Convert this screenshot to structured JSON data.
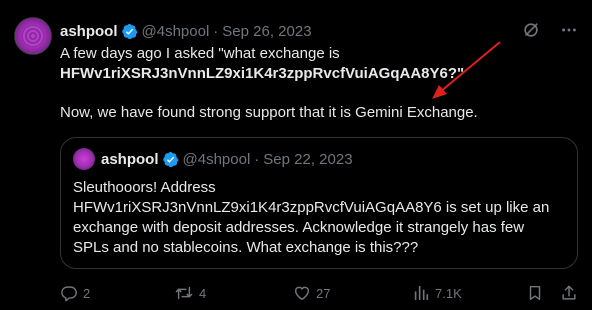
{
  "tweet": {
    "author_name": "ashpool",
    "handle": "@4shpool",
    "separator": "·",
    "date": "Sep 26, 2023",
    "text_line1": "A few days ago I asked \"what exchange is",
    "text_line2": "HFWv1riXSRJ3nVnnLZ9xi1K4r3zppRvcfVuiAGqAA8Y6?\"",
    "text_line3": "Now, we have found strong support that it is Gemini Exchange."
  },
  "quoted_tweet": {
    "author_name": "ashpool",
    "handle": "@4shpool",
    "separator": "·",
    "date": "Sep 22, 2023",
    "lines": [
      "Sleuthooors! Address",
      "HFWv1riXSRJ3nVnnLZ9xi1K4r3zppRvcfVuiAGqAA8Y6 is set up like an",
      "exchange with deposit addresses. Acknowledge it strangely has few",
      "SPLs and no stablecoins. What exchange is this???"
    ]
  },
  "actions": {
    "replies": "2",
    "reposts": "4",
    "likes": "27",
    "views": "7.1K"
  },
  "colors": {
    "background": "#000000",
    "text": "#e7e9ea",
    "muted": "#71767b",
    "verified": "#1d9bf0",
    "annotation_arrow": "#e0201c",
    "border": "#2f3336"
  },
  "icons": {
    "header": [
      "grok-icon",
      "more-icon"
    ],
    "actions": [
      "reply-icon",
      "repost-icon",
      "like-icon",
      "views-icon",
      "bookmark-icon",
      "share-icon"
    ]
  }
}
